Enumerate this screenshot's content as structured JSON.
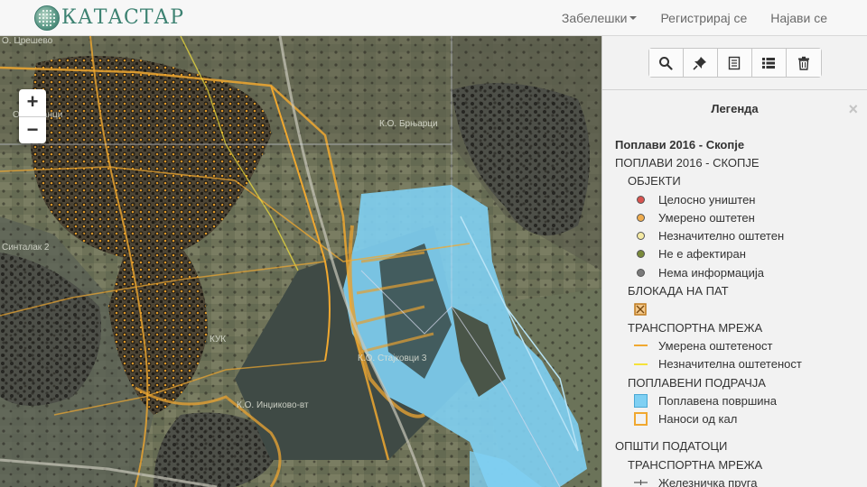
{
  "app": {
    "brand": "КАТАСТАР"
  },
  "nav": {
    "notes_label": "Забелешки",
    "register_label": "Регистрирај се",
    "login_label": "Најави се"
  },
  "map": {
    "zoom_in": "+",
    "zoom_out": "−",
    "labels": {
      "cresevo": "О. Црешево",
      "ognjanci": "О. Огњанци",
      "sintalak": "Синталак 2",
      "brnjarci": "К.О. Брњарци",
      "kuk": "КУК",
      "stajkovci": "К.О. Стајковци 3",
      "indjikovo": "К.О. Инџиково-вт"
    }
  },
  "toolbar": {
    "icons": [
      "search-icon",
      "pin-icon",
      "document-icon",
      "list-icon",
      "trash-icon"
    ]
  },
  "legend": {
    "title": "Легенда",
    "close": "×",
    "layer_title": "Поплави 2016 - Скопје",
    "group_title": "ПОПЛАВИ 2016 - СКОПЈЕ",
    "objects": {
      "heading": "ОБЈЕКТИ",
      "items": [
        {
          "label": "Целосно уништен",
          "color": "#d9534f"
        },
        {
          "label": "Умерено оштетен",
          "color": "#f0ad4e"
        },
        {
          "label": "Незначително оштетен",
          "color": "#f5eaa3"
        },
        {
          "label": "Не е афектиран",
          "color": "#7a8a3a"
        },
        {
          "label": "Нема информација",
          "color": "#7a7a7a"
        }
      ]
    },
    "blockade": {
      "heading": "БЛОКАДА НА ПАТ"
    },
    "transport": {
      "heading": "ТРАНСПОРТНА МРЕЖА",
      "items": [
        {
          "label": "Умерена оштетеност",
          "color": "#f0a830"
        },
        {
          "label": "Незначителна оштетеност",
          "color": "#f5e23a"
        }
      ]
    },
    "flooded": {
      "heading": "ПОПЛАВЕНИ ПОДРАЧЈА",
      "items": [
        {
          "label": "Поплавена површина",
          "color": "#7fd0f3"
        },
        {
          "label": "Наноси од кал",
          "color": "#f0a830"
        }
      ]
    },
    "general": {
      "heading": "ОПШТИ ПОДАТОЦИ",
      "sub": "ТРАНСПОРТНА МРЕЖА",
      "items": [
        {
          "label": "Железничка пруга"
        }
      ]
    }
  }
}
